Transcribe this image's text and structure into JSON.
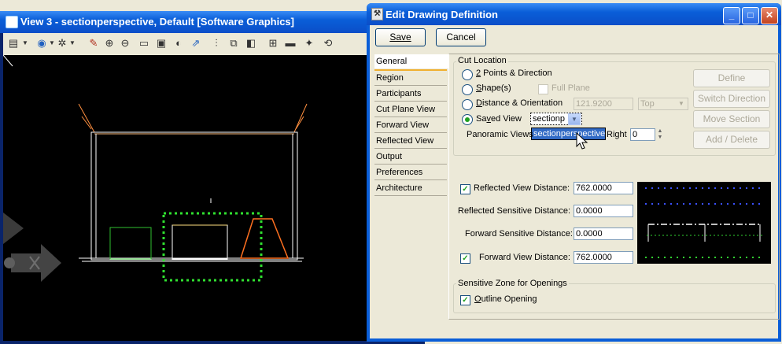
{
  "view_window": {
    "title": "View 3 - sectionperspective, Default [Software Graphics]",
    "toolbar_icons": [
      "view-attributes-icon",
      "view-display-mode-icon",
      "view-settings-icon",
      "update-view-icon",
      "zoom-in-icon",
      "zoom-out-icon",
      "window-area-icon",
      "fit-view-icon",
      "rotate-view-icon",
      "pan-view-icon",
      "walk-icon",
      "copy-view-icon",
      "previous-view-icon",
      "next-view-icon",
      "clip-volume-icon",
      "clip-mask-icon",
      "camera-icon",
      "view-toggle-icon"
    ]
  },
  "dialog": {
    "title": "Edit Drawing Definition",
    "save_label": "Save",
    "cancel_label": "Cancel",
    "tabs": [
      "General",
      "Region",
      "Participants",
      "Cut Plane View",
      "Forward View",
      "Reflected View",
      "Output",
      "Preferences",
      "Architecture"
    ],
    "selected_tab": "General",
    "cut_location": {
      "label": "Cut Location",
      "options": [
        {
          "label": "2 Points & Direction",
          "mnemonic": "2",
          "rest": " Points & Direction",
          "selected": false
        },
        {
          "label": "Shape(s)",
          "mnemonic": "S",
          "rest": "hape(s)",
          "selected": false
        },
        {
          "label": "Distance & Orientation",
          "mnemonic": "D",
          "rest": "istance & Orientation",
          "selected": false
        },
        {
          "label": "Saved View",
          "mnemonic": "S",
          "prefix": "Sa",
          "rest": "ved View",
          "selected": true
        }
      ],
      "full_plane_label": "Full Plane",
      "distance_value": "121.9200",
      "orientation_value": "Top",
      "saved_view_value": "sectionp",
      "dropdown_item": "sectionperspective",
      "panoramic_views_label": "Panoramic Views",
      "right_label": "Right",
      "right_value": "0",
      "buttons": [
        "Define",
        "Switch Direction",
        "Move Section",
        "Add / Delete"
      ]
    },
    "distances": {
      "reflected_view_label": "Reflected View Distance:",
      "reflected_view_value": "762.0000",
      "reflected_sensitive_label": "Reflected Sensitive Distance:",
      "reflected_sensitive_value": "0.0000",
      "forward_sensitive_label": "Forward Sensitive Distance:",
      "forward_sensitive_value": "0.0000",
      "forward_view_label": "Forward View Distance:",
      "forward_view_value": "762.0000"
    },
    "sensitive_zone": {
      "label": "Sensitive Zone for Openings",
      "outline_opening_label": "Outline Opening",
      "outline_opening_checked": true
    }
  },
  "colors": {
    "title_bar": "#0a5ed8",
    "canvas": "#000000",
    "selection": "#316ac5",
    "check": "#21a121"
  }
}
